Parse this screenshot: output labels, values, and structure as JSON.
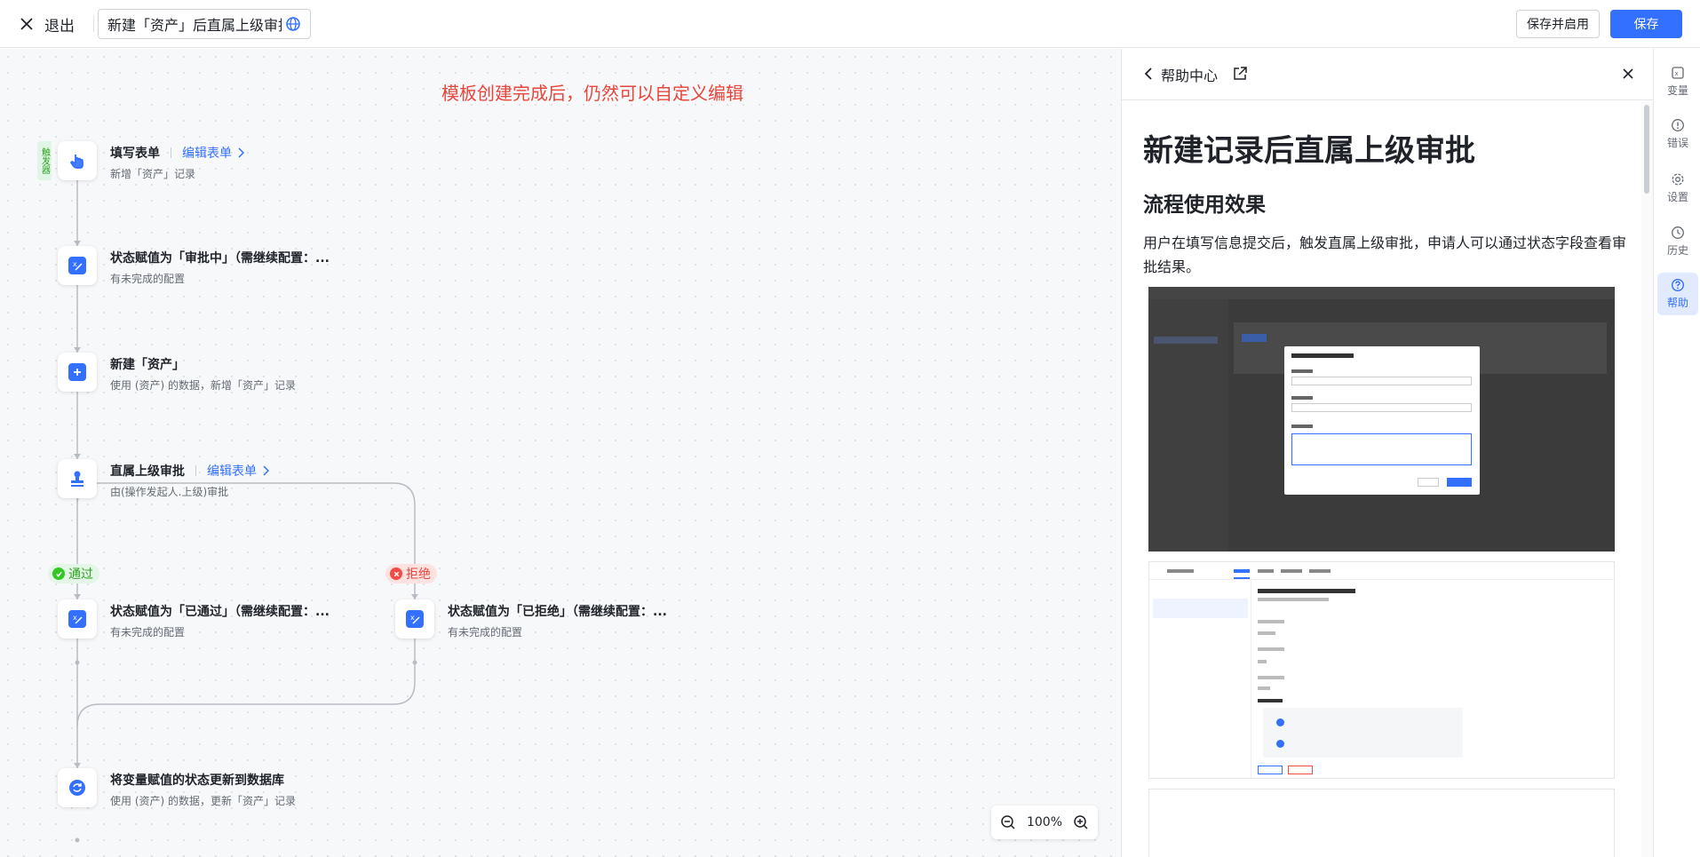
{
  "topbar": {
    "exit_label": "退出",
    "title": "新建「资产」后直属上级审批",
    "save_enable_label": "保存并启用",
    "save_label": "保存"
  },
  "canvas": {
    "annotation": "模板创建完成后，仍然可以自定义编辑",
    "trigger_tag": "触发器",
    "nodes": [
      {
        "title": "填写表单",
        "link": "编辑表单",
        "subtitle": "新增「资产」记录"
      },
      {
        "title": "状态赋值为「审批中」（需继续配置：...",
        "subtitle": "有未完成的配置"
      },
      {
        "title": "新建「资产」",
        "subtitle": "使用 (资产) 的数据，新增「资产」记录"
      },
      {
        "title": "直属上级审批",
        "link": "编辑表单",
        "subtitle": "由(操作发起人.上级)审批"
      },
      {
        "title": "状态赋值为「已通过」（需继续配置：...",
        "subtitle": "有未完成的配置"
      },
      {
        "title": "状态赋值为「已拒绝」（需继续配置：...",
        "subtitle": "有未完成的配置"
      },
      {
        "title": "将变量赋值的状态更新到数据库",
        "subtitle": "使用 (资产) 的数据，更新「资产」记录"
      }
    ],
    "branches": {
      "pass": "通过",
      "reject": "拒绝"
    },
    "zoom": "100%"
  },
  "help": {
    "header_title": "帮助中心",
    "h1": "新建记录后直属上级审批",
    "h2": "流程使用效果",
    "paragraph": "用户在填写信息提交后，触发直属上级审批，申请人可以通过状态字段查看审批结果。"
  },
  "rail": {
    "items": [
      {
        "label": "变量",
        "icon": "variable-icon"
      },
      {
        "label": "错误",
        "icon": "error-icon"
      },
      {
        "label": "设置",
        "icon": "gear-icon"
      },
      {
        "label": "历史",
        "icon": "clock-icon"
      },
      {
        "label": "帮助",
        "icon": "help-icon"
      }
    ]
  },
  "colors": {
    "accent": "#3370ff",
    "pass": "#34c724",
    "reject": "#f54a45",
    "annotation": "#e8453c"
  }
}
